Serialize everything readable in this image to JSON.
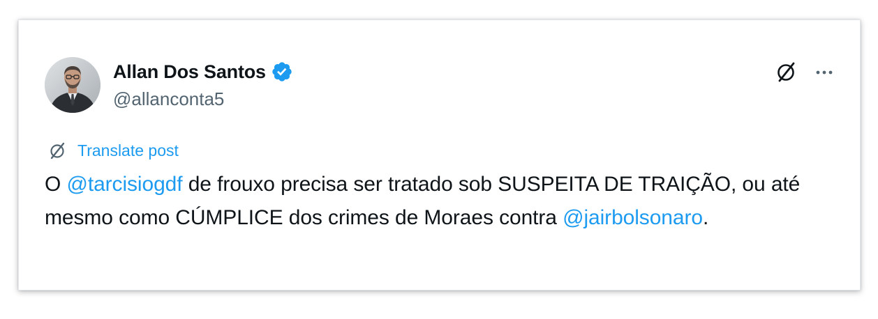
{
  "author": {
    "display_name": "Allan Dos Santos",
    "handle": "@allanconta5",
    "verified": true
  },
  "header_actions": {
    "grok_icon": "grok-slash-icon",
    "more_icon": "more-horizontal-icon"
  },
  "translate": {
    "icon": "grok-slash-icon",
    "label": "Translate post"
  },
  "tweet": {
    "segments": [
      {
        "type": "text",
        "value": "O "
      },
      {
        "type": "mention",
        "value": "@tarcisiogdf"
      },
      {
        "type": "text",
        "value": " de frouxo precisa ser tratado sob SUSPEITA DE TRAIÇÃO, ou até mesmo como CÚMPLICE dos crimes de Moraes contra "
      },
      {
        "type": "mention",
        "value": "@jairbolsonaro"
      },
      {
        "type": "text",
        "value": "."
      }
    ]
  },
  "colors": {
    "accent": "#1d9bf0",
    "text": "#0f1419",
    "secondary": "#536471"
  }
}
